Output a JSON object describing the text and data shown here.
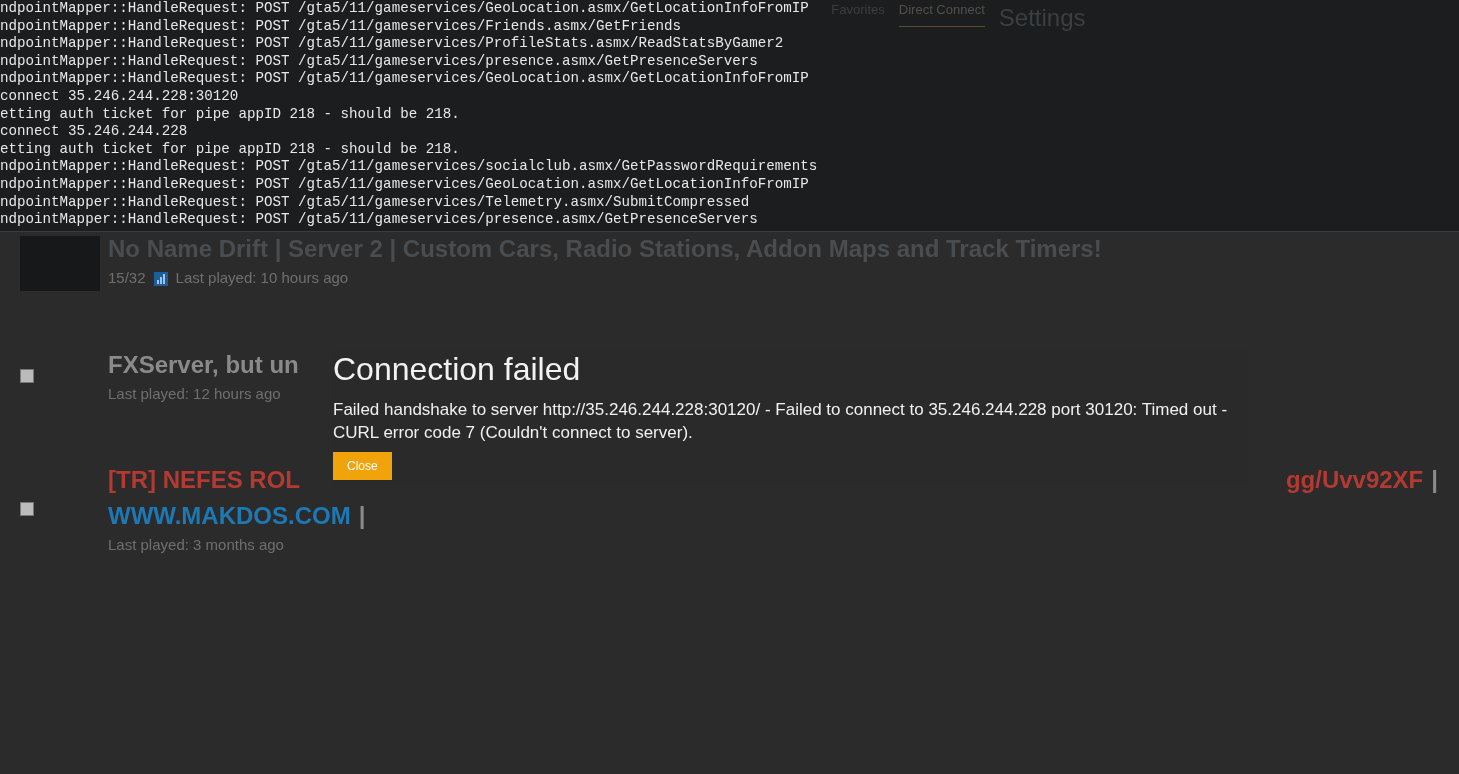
{
  "console": {
    "lines": [
      "ndpointMapper::HandleRequest: POST /gta5/11/gameservices/GeoLocation.asmx/GetLocationInfoFromIP",
      "ndpointMapper::HandleRequest: POST /gta5/11/gameservices/Friends.asmx/GetFriends",
      "ndpointMapper::HandleRequest: POST /gta5/11/gameservices/ProfileStats.asmx/ReadStatsByGamer2",
      "ndpointMapper::HandleRequest: POST /gta5/11/gameservices/presence.asmx/GetPresenceServers",
      "ndpointMapper::HandleRequest: POST /gta5/11/gameservices/GeoLocation.asmx/GetLocationInfoFromIP",
      "connect 35.246.244.228:30120",
      "etting auth ticket for pipe appID 218 - should be 218.",
      "connect 35.246.244.228",
      "etting auth ticket for pipe appID 218 - should be 218.",
      "ndpointMapper::HandleRequest: POST /gta5/11/gameservices/socialclub.asmx/GetPasswordRequirements",
      "ndpointMapper::HandleRequest: POST /gta5/11/gameservices/GeoLocation.asmx/GetLocationInfoFromIP",
      "ndpointMapper::HandleRequest: POST /gta5/11/gameservices/Telemetry.asmx/SubmitCompressed",
      "ndpointMapper::HandleRequest: POST /gta5/11/gameservices/presence.asmx/GetPresenceServers"
    ]
  },
  "tabs": [
    {
      "label": "Favorites",
      "selected": false
    },
    {
      "label": "Direct Connect",
      "selected": true
    }
  ],
  "heading": "Settings",
  "servers": [
    {
      "kind": "image",
      "name_lines": [
        [
          [
            {
              "text": "No Name Drift | Server 2 | Custom Cars, Radio Stations, Addon Maps and Track Timers!",
              "color": "#4a4d50"
            }
          ]
        ]
      ],
      "players": "15/32",
      "last_played": "Last played: 10 hours ago"
    },
    {
      "kind": "broken",
      "name_lines": [
        [
          [
            {
              "text": "FXServer, but un",
              "color": "#8a8a8a"
            }
          ]
        ]
      ],
      "last_played": "Last played: 12 hours ago"
    },
    {
      "kind": "broken",
      "name_lines": [
        [
          [
            {
              "text": "[TR] NEFES ROL",
              "color": "#b23a32"
            }
          ],
          [
            {
              "text": "gg/Uvv92XF",
              "color": "#b23a32"
            },
            {
              "text": "|",
              "color": "#8a8a8a"
            }
          ]
        ],
        [
          [
            {
              "text": "WWW.MAKDOS.COM",
              "color": "#1e78b4"
            },
            {
              "text": "|",
              "color": "#8a8a8a"
            }
          ]
        ]
      ],
      "last_played": "Last played: 3 months ago"
    }
  ],
  "dialog": {
    "title": "Connection failed",
    "message": "Failed handshake to server http://35.246.244.228:30120/ - Failed to connect to 35.246.244.228 port 30120: Timed out - CURL error code 7 (Couldn't connect to server).",
    "button": "Close"
  }
}
